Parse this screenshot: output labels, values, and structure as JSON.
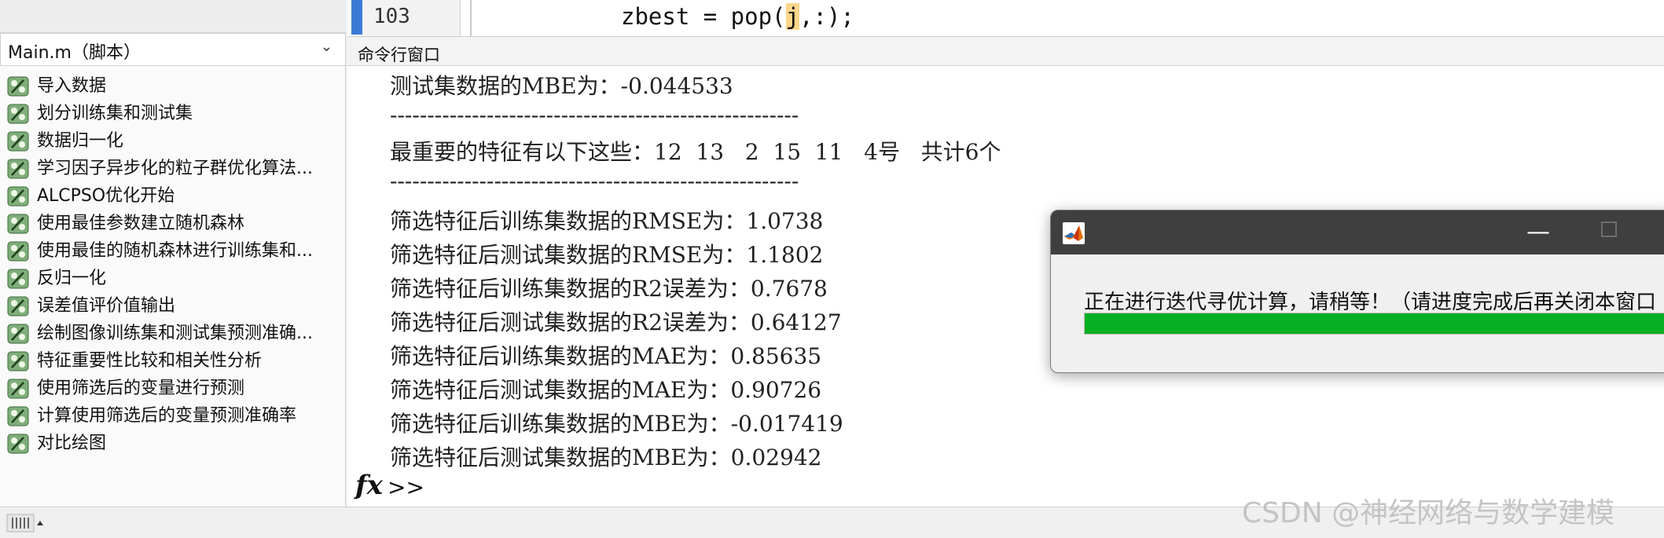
{
  "editor": {
    "line_number": "103",
    "code_before": "zbest = pop(",
    "code_highlight": "j",
    "code_after": ",:);"
  },
  "file_selector": {
    "label": "Main.m（脚本）"
  },
  "sections": [
    {
      "label": "导入数据"
    },
    {
      "label": "划分训练集和测试集"
    },
    {
      "label": "数据归一化"
    },
    {
      "label": "学习因子异步化的粒子群优化算法..."
    },
    {
      "label": "ALCPSO优化开始"
    },
    {
      "label": "使用最佳参数建立随机森林"
    },
    {
      "label": "使用最佳的随机森林进行训练集和..."
    },
    {
      "label": "反归一化"
    },
    {
      "label": "误差值评价值输出"
    },
    {
      "label": "绘制图像训练集和测试集预测准确..."
    },
    {
      "label": "特征重要性比较和相关性分析"
    },
    {
      "label": "使用筛选后的变量进行预测"
    },
    {
      "label": "计算使用筛选后的变量预测准确率"
    },
    {
      "label": "对比绘图"
    }
  ],
  "command_window": {
    "title": "命令行窗口",
    "lines": [
      "测试集数据的MBE为：-0.044533",
      "-------------------------------------------------------",
      "最重要的特征有以下这些：12  13   2  15  11   4号   共计6个",
      "-------------------------------------------------------",
      "筛选特征后训练集数据的RMSE为：1.0738",
      "筛选特征后测试集数据的RMSE为：1.1802",
      "筛选特征后训练集数据的R2误差为：0.7678",
      "筛选特征后测试集数据的R2误差为：0.64127",
      "筛选特征后训练集数据的MAE为：0.85635",
      "筛选特征后测试集数据的MAE为：0.90726",
      "筛选特征后训练集数据的MBE为：-0.017419",
      "筛选特征后测试集数据的MBE为：0.02942"
    ],
    "prompt_fx": "fx",
    "prompt": ">>"
  },
  "dialog": {
    "message": "正在进行迭代寻优计算，请稍等！（请进度完成后再关闭本窗口",
    "progress_fraction": 1.0,
    "minimize_glyph": "—",
    "progress_color": "#06b025"
  },
  "watermark": "CSDN @神经网络与数学建模",
  "colors": {
    "line_marker": "#3a7bd5",
    "highlight": "#fcd68a",
    "dialog_title": "#3f3f3f"
  }
}
